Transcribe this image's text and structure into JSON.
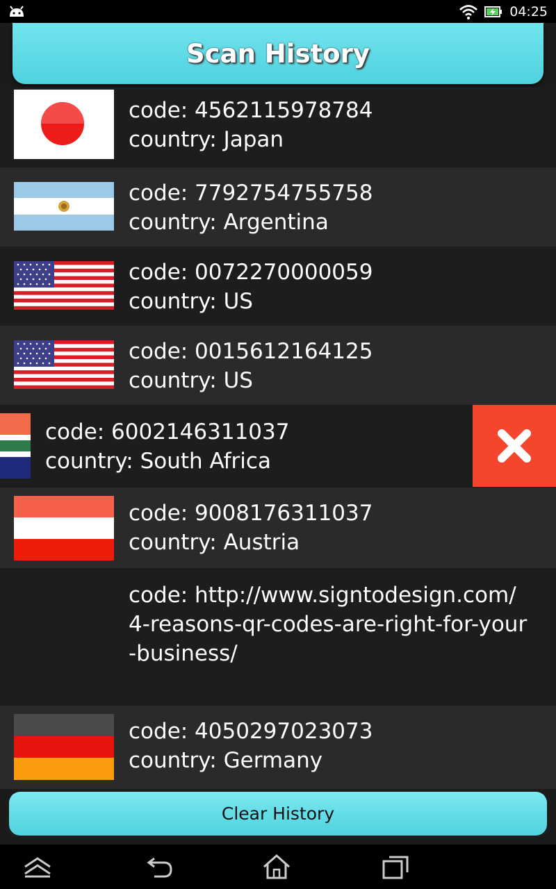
{
  "status_bar": {
    "time": "04:25",
    "icons": [
      "android-notification-icon",
      "wifi-icon",
      "battery-charging-icon"
    ]
  },
  "header": {
    "title": "Scan History"
  },
  "history": [
    {
      "code": "code: 4562115978784",
      "country": "country: Japan",
      "flag": "japan"
    },
    {
      "code": "code: 7792754755758",
      "country": "country: Argentina",
      "flag": "argentina"
    },
    {
      "code": "code: 0072270000059",
      "country": "country: US",
      "flag": "us"
    },
    {
      "code": "code: 0015612164125",
      "country": "country: US",
      "flag": "us"
    },
    {
      "code": "code: 6002146311037",
      "country": "country: South Africa",
      "flag": "south-africa",
      "swiped": true
    },
    {
      "code": "code: 9008176311037",
      "country": "country: Austria",
      "flag": "austria"
    },
    {
      "code": "code: http://www.signtodesign.com/4-reasons-qr-codes-are-right-for-your-business/",
      "flag": "none"
    },
    {
      "code": "code: 4050297023073",
      "country": "country: Germany",
      "flag": "germany"
    }
  ],
  "clear_button": {
    "label": "Clear History"
  },
  "colors": {
    "accent": "#5fdbe7",
    "delete": "#f5452d"
  },
  "nav_bar": {
    "icons": [
      "recent-apps-up-icon",
      "back-icon",
      "home-icon",
      "recent-apps-icon"
    ]
  }
}
